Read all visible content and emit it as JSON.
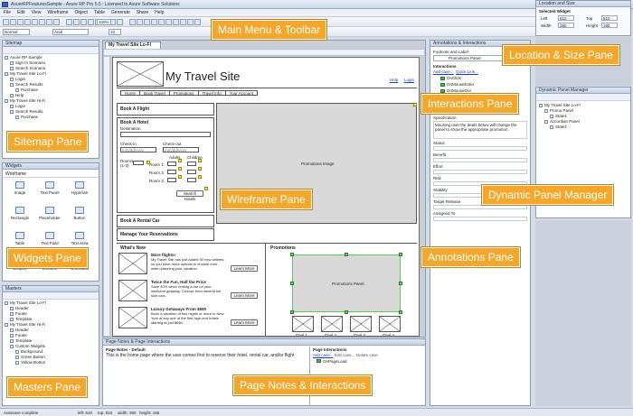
{
  "window": {
    "title": "AxureRPFeaturesSample - Axure RP Pro 5.5 : Licensed to Axure Software Solutions"
  },
  "menu": [
    "File",
    "Edit",
    "View",
    "Wireframe",
    "Object",
    "Table",
    "Generate",
    "Share",
    "Help"
  ],
  "toolbar": {
    "style": "Normal",
    "font": "Arial",
    "size": "10",
    "zoom": "100%"
  },
  "sitemap": {
    "header": "Sitemap",
    "items": [
      "Axure RP Sample",
      "Sign In Scenario",
      "Search Scenario",
      "My Travel Site Lo-Fi",
      "Login",
      "Search Results",
      "Purchase",
      "Help",
      "My Travel Site Hi-Fi",
      "Login",
      "Search Results",
      "Purchase"
    ]
  },
  "widgets": {
    "header": "Widgets",
    "library": "Wireframe",
    "items": [
      "Image",
      "Text Panel",
      "Hyperlink",
      "Rectangle",
      "Placeholder",
      "Button",
      "Table",
      "Text Field",
      "Text Area",
      "Droplist",
      "List Box",
      "Checkbox"
    ]
  },
  "masters": {
    "header": "Masters",
    "items": [
      "My Travel Site Lo-Fi",
      "Header",
      "Footer",
      "Template",
      "My Travel Site Hi-Fi",
      "Header",
      "Footer",
      "Template",
      "Custom Widgets",
      "Background",
      "Green Button",
      "Yellow Button"
    ]
  },
  "tab": {
    "label": "My Travel Site Lo-Fi"
  },
  "wireframe": {
    "site_title": "My Travel Site",
    "help": "Help",
    "login": "Login",
    "nav": [
      "Home",
      "Book Travel",
      "Promotions",
      "Travel Info",
      "Your Account"
    ],
    "book_flight": "Book A Flight",
    "book_hotel": "Book A Hotel",
    "destination": "Destination",
    "checkin": "Check-in",
    "checkout": "Check-out",
    "date_ph": "mm/dd/yyyy",
    "rooms": "Rooms",
    "rooms_sub": "(1-3)",
    "adults": "Adults",
    "children": "Children",
    "room1": "Room 1:",
    "room2": "Room 2:",
    "room3": "Room 3:",
    "search_hotels": "Search Hotels",
    "book_car": "Book A Rental Car",
    "manage": "Manage Your Reservations",
    "promo_image": "Promotions Image",
    "whats_new": "What's New",
    "news": [
      {
        "title": "More flights!",
        "body": "My Travel Site has just added 50 new airlines, so you have more options to choose from when planning your vacation.",
        "btn": "Learn More"
      },
      {
        "title": "Twice the Fun, Half the Price",
        "body": "Save 40% when renting a car on your weekend getaway. Choose from several full size cars.",
        "btn": "Learn More"
      },
      {
        "title": "Luxury Getaways From $650",
        "body": "Book a vacation of two nights or more to New York at any one of the fine high-end hotels starting at just $650.",
        "btn": "Learn More"
      }
    ],
    "promotions": "Promotions",
    "promo_panel": "Promotions Panel",
    "deals": [
      "Deal 1",
      "Deal 2",
      "Deal 3",
      "Deal 4"
    ]
  },
  "interactions": {
    "header": "Annotations & Interactions",
    "footnote": "Footnote and Label",
    "footnote_value": "Promotions Panel",
    "section": "Interactions",
    "add_case": "Add case...",
    "quick_link": "Quick Link...",
    "events": [
      "OnClick",
      "OnMouseEnter",
      "OnMouseOut"
    ]
  },
  "annotations": {
    "spec_label": "Specification",
    "spec_text": "Mousing over the deals below will change the panel to show the appropriate promotion.",
    "fields": [
      "Status",
      "Benefit",
      "Effort",
      "Risk",
      "Stability",
      "Target Release",
      "Assigned To"
    ]
  },
  "location": {
    "header": "Location and Size",
    "selected": "Selected Widget",
    "left_label": "Left",
    "left": "610",
    "top_label": "Top",
    "top": "810",
    "width_label": "Width",
    "width": "380",
    "height_label": "Height",
    "height": "195"
  },
  "dpm": {
    "header": "Dynamic Panel Manager",
    "items": [
      "My Travel Site Lo-Fi",
      "Promo Panel",
      "State1",
      "Accordian Panel",
      "State1"
    ]
  },
  "pagenotes": {
    "header": "Page Notes & Page Interactions",
    "notes_label": "Page Notes - Default",
    "notes_text": "This is the home page where the user comes first to reserve their hotel, rental car, and/or flight",
    "pi_label": "Page Interactions",
    "add_case": "Add case...",
    "edit_case": "Edit case...",
    "delete_case": "Delete case",
    "event": "OnPageLoad"
  },
  "status": {
    "text": "Autosave complete",
    "left": "left: 610",
    "top": "top: 810",
    "width": "width: 380",
    "height": "height: 195"
  },
  "callouts": {
    "menu": "Main Menu & Toolbar",
    "location": "Location & Size Pane",
    "sitemap": "Sitemap Pane",
    "interactions": "Interactions Pane",
    "wireframe": "Wireframe Pane",
    "dpm": "Dynamic Panel Manager",
    "widgets": "Widgets Pane",
    "annotations": "Annotations Pane",
    "masters": "Masters Pane",
    "pagenotes": "Page Notes & Interactions"
  },
  "colors": {
    "callout": "#f4a72a",
    "panel_header": "#c5d2e6",
    "link": "#1a3fbf",
    "selection": "#5ec75e"
  }
}
